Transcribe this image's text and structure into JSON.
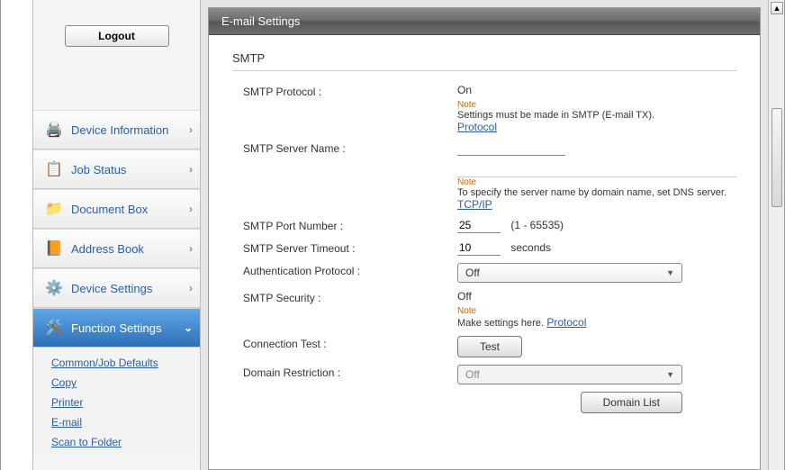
{
  "sidebar": {
    "logout": "Logout",
    "items": [
      {
        "label": "Device Information"
      },
      {
        "label": "Job Status"
      },
      {
        "label": "Document Box"
      },
      {
        "label": "Address Book"
      },
      {
        "label": "Device Settings"
      },
      {
        "label": "Function Settings"
      }
    ],
    "sub": [
      "Common/Job Defaults",
      "Copy",
      "Printer",
      "E-mail",
      "Scan to Folder"
    ]
  },
  "panel": {
    "title": "E-mail Settings",
    "section": "SMTP",
    "protocol_label": "SMTP Protocol :",
    "protocol_value": "On",
    "note_label": "Note",
    "protocol_note": "Settings must be made in SMTP (E-mail TX).",
    "protocol_link": "Protocol",
    "server_name_label": "SMTP Server Name :",
    "server_name_value": "",
    "server_note": "To specify the server name by domain name, set DNS server.",
    "tcpip_link": "TCP/IP",
    "port_label": "SMTP Port Number :",
    "port_value": "25",
    "port_range": "(1 - 65535)",
    "timeout_label": "SMTP Server Timeout :",
    "timeout_value": "10",
    "timeout_unit": "seconds",
    "auth_label": "Authentication Protocol :",
    "auth_value": "Off",
    "security_label": "SMTP Security :",
    "security_value": "Off",
    "security_note": "Make settings here.",
    "security_link": "Protocol",
    "conn_test_label": "Connection Test :",
    "test_btn": "Test",
    "domain_restr_label": "Domain Restriction :",
    "domain_restr_value": "Off",
    "domain_list_btn": "Domain List"
  }
}
